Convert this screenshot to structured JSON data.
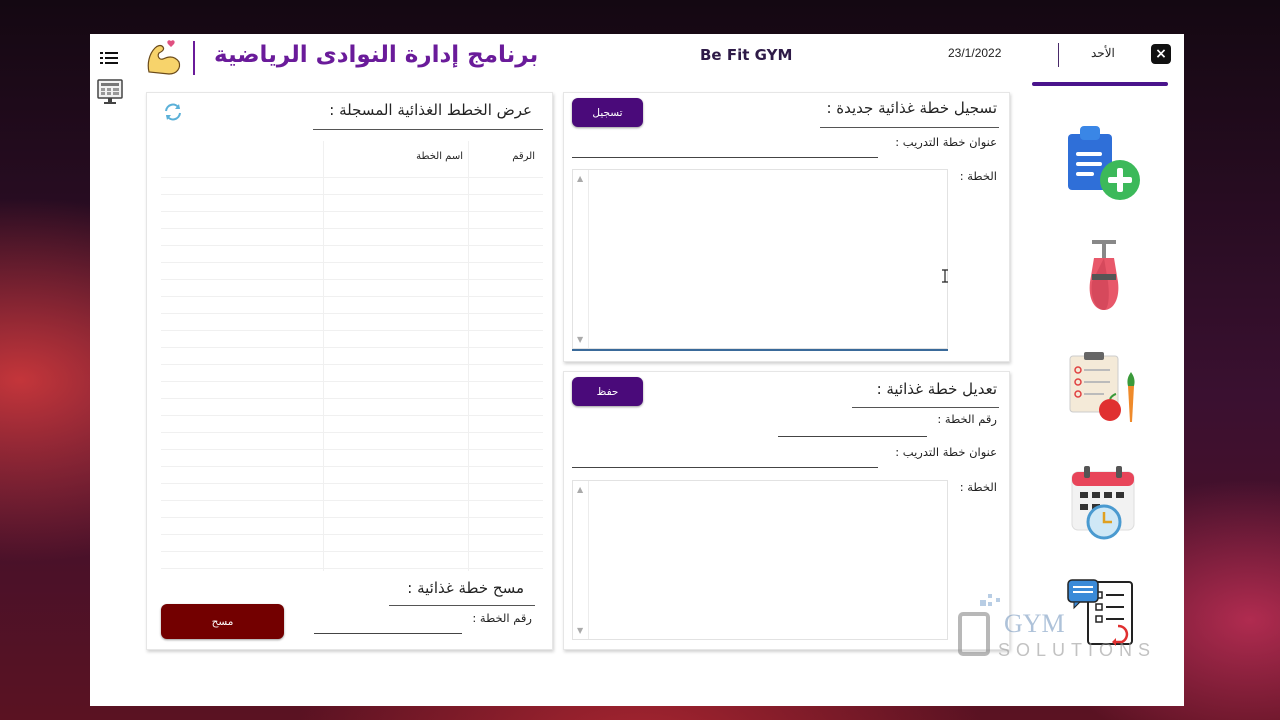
{
  "header": {
    "app_title": "برنامج إدارة النوادى الرياضية",
    "gym_name": "Be Fit GYM",
    "date": "23/1/2022",
    "day": "الأحد",
    "close_label": "×"
  },
  "register_panel": {
    "heading": "تسجيل خطة غذائية جديدة :",
    "button_label": "تسجيل",
    "title_label": "عنوان خطة التدريب :",
    "title_value": "",
    "plan_label": "الخطة :",
    "plan_value": ""
  },
  "edit_panel": {
    "heading": "تعديل خطة غذائية :",
    "button_label": "حفظ",
    "number_label": "رقم الخطة :",
    "number_value": "",
    "title_label": "عنوان خطة التدريب :",
    "title_value": "",
    "plan_label": "الخطة :",
    "plan_value": ""
  },
  "list_panel": {
    "heading": "عرض الخطط الغذائية المسجلة :",
    "columns": [
      "الرقم",
      "اسم الخطة",
      ""
    ],
    "rows": []
  },
  "delete_panel": {
    "heading": "مسح خطة غذائية :",
    "number_label": "رقم الخطة :",
    "number_value": "",
    "button_label": "مسح"
  },
  "sidebar": {
    "icons": [
      "add-clipboard-icon",
      "punching-bag-icon",
      "nutrition-plan-icon",
      "calendar-clock-icon",
      "schedule-chat-icon"
    ]
  },
  "watermark": {
    "line1": "GYM",
    "line2": "SOLUTIONS"
  },
  "colors": {
    "accent": "#4a0a7a",
    "title": "#6a1b9a",
    "danger": "#730000"
  }
}
